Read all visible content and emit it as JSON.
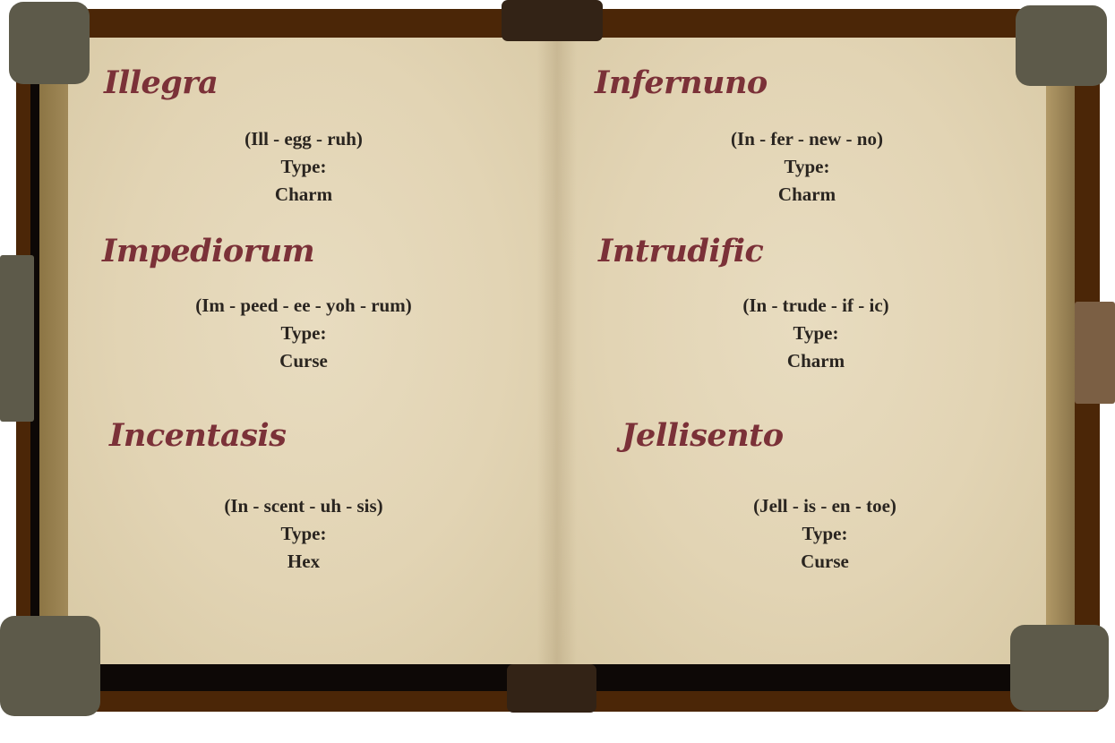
{
  "spells": [
    {
      "name": "Illegra",
      "pronunciation": "(Ill - egg - ruh)",
      "type_label": "Type:",
      "type": "Charm"
    },
    {
      "name": "Impediorum",
      "pronunciation": "(Im - peed - ee - yoh - rum)",
      "type_label": "Type:",
      "type": "Curse"
    },
    {
      "name": "Incentasis",
      "pronunciation": "(In - scent - uh - sis)",
      "type_label": "Type:",
      "type": "Hex"
    },
    {
      "name": "Infernuno",
      "pronunciation": "(In - fer - new - no)",
      "type_label": "Type:",
      "type": "Charm"
    },
    {
      "name": "Intrudific",
      "pronunciation": "(In - trude - if - ic)",
      "type_label": "Type:",
      "type": "Charm"
    },
    {
      "name": "Jellisento",
      "pronunciation": "(Jell - is - en - toe)",
      "type_label": "Type:",
      "type": "Curse"
    }
  ],
  "colors": {
    "cover": "#4b2607",
    "page": "#e2d4b4",
    "spell_name": "#7b3138",
    "text": "#2a2520",
    "clasp": "#332316",
    "corner": "#5d5a4a"
  }
}
